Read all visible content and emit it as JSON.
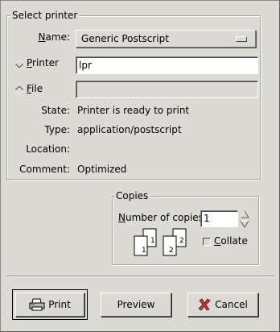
{
  "select_printer": {
    "frame_title": "Select printer",
    "name_label": "Name:",
    "name_value": "Generic Postscript",
    "printer_label": "Printer",
    "printer_value": "lpr",
    "file_label": "File",
    "file_value": "",
    "state_label": "State:",
    "state_value": "Printer is ready to print",
    "type_label": "Type:",
    "type_value": "application/postscript",
    "location_label": "Location:",
    "location_value": "",
    "comment_label": "Comment:",
    "comment_value": "Optimized"
  },
  "copies": {
    "frame_title": "Copies",
    "number_label": "Number of copies:",
    "number_value": "1",
    "collate_label": "Collate",
    "collate_checked": false,
    "page_numbers": [
      "1",
      "1",
      "2",
      "2"
    ]
  },
  "buttons": {
    "print": "Print",
    "preview": "Preview",
    "cancel": "Cancel"
  }
}
